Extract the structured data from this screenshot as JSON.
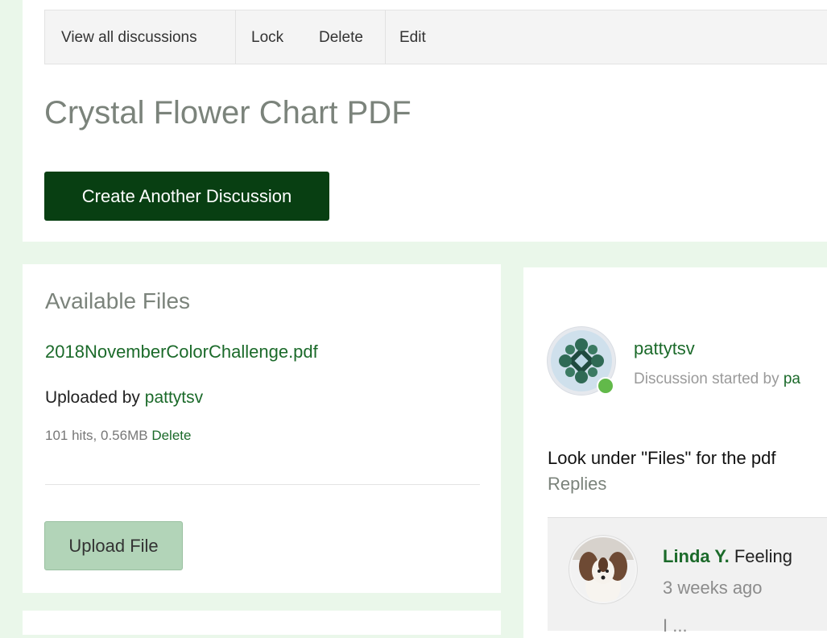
{
  "toolbar": {
    "view_all": "View all discussions",
    "lock": "Lock",
    "delete": "Delete",
    "edit": "Edit"
  },
  "discussion": {
    "title": "Crystal Flower Chart PDF",
    "create_button": "Create Another Discussion"
  },
  "files": {
    "heading": "Available Files",
    "items": [
      {
        "name": "2018NovemberColorChallenge.pdf",
        "uploaded_by_label": "Uploaded by",
        "uploader": "pattytsv",
        "stats": "101 hits, 0.56MB",
        "delete_label": "Delete"
      }
    ],
    "upload_button": "Upload File"
  },
  "post": {
    "author": "pattytsv",
    "started_prefix": "Discussion started by",
    "started_user_visible": "pa",
    "body": "Look under \"Files\" for the pdf",
    "author_online": true
  },
  "replies": {
    "heading": "Replies",
    "items": [
      {
        "name": "Linda Y.",
        "text_fragment": "Feeling",
        "time": "3 weeks ago",
        "more_fragment": "I ..."
      }
    ]
  },
  "colors": {
    "brand_dark_green": "#083f12",
    "link_green": "#1b6a2a",
    "upload_button": "#b2d4b8",
    "online": "#62b94a",
    "page_bg": "#eaf7ea"
  }
}
